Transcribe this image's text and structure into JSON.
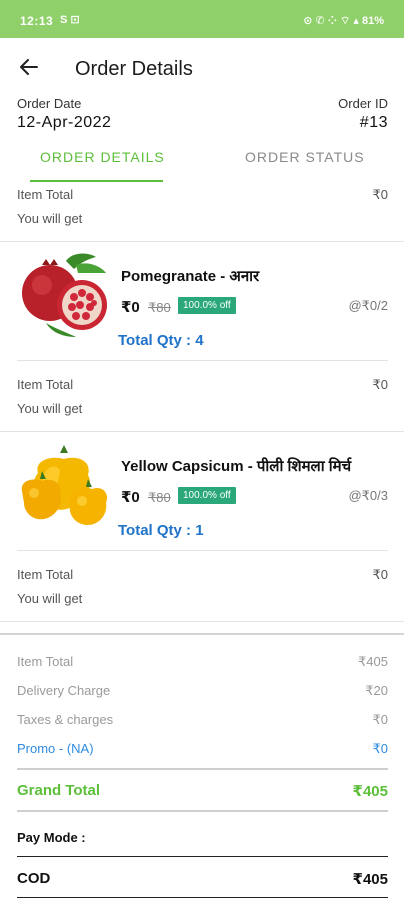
{
  "status_bar": {
    "time": "12:13",
    "left_icons": "S  ⊡",
    "right_icons": "⊙ ✆ ⁘ ⌔ ▴ 81%"
  },
  "header": {
    "title": "Order Details"
  },
  "order": {
    "date_label": "Order Date",
    "date": "12-Apr-2022",
    "id_label": "Order ID",
    "id": "#13"
  },
  "tabs": {
    "details": "ORDER DETAILS",
    "status": "ORDER STATUS"
  },
  "top_totals": {
    "item_total_label": "Item Total",
    "item_total": "₹0",
    "you_will_get_label": "You will get"
  },
  "items": [
    {
      "name": "Pomegranate - अनार",
      "price": "₹0",
      "mrp": "₹80",
      "discount": "100.0% off",
      "unit_price": "@₹0/2",
      "qty": "Total Qty : 4",
      "item_total_label": "Item Total",
      "item_total": "₹0",
      "you_will_get_label": "You will get"
    },
    {
      "name": "Yellow Capsicum - पीली शिमला मिर्च",
      "price": "₹0",
      "mrp": "₹80",
      "discount": "100.0% off",
      "unit_price": "@₹0/3",
      "qty": "Total Qty : 1",
      "item_total_label": "Item Total",
      "item_total": "₹0",
      "you_will_get_label": "You will get"
    }
  ],
  "summary": {
    "item_total_label": "Item Total",
    "item_total": "₹405",
    "delivery_label": "Delivery Charge",
    "delivery": "₹20",
    "taxes_label": "Taxes & charges",
    "taxes": "₹0",
    "promo_label": "Promo - (NA)",
    "promo": "₹0",
    "grand_total_label": "Grand Total",
    "grand_total": "₹405",
    "pay_mode_label": "Pay Mode :",
    "pay_mode": "COD",
    "pay_amount": "₹405"
  },
  "colors": {
    "accent_green": "#5cbf3a",
    "status_bar": "#8fd06a",
    "qty_blue": "#1f73c8",
    "badge": "#2aa87a",
    "promo_blue": "#2f8be0"
  }
}
